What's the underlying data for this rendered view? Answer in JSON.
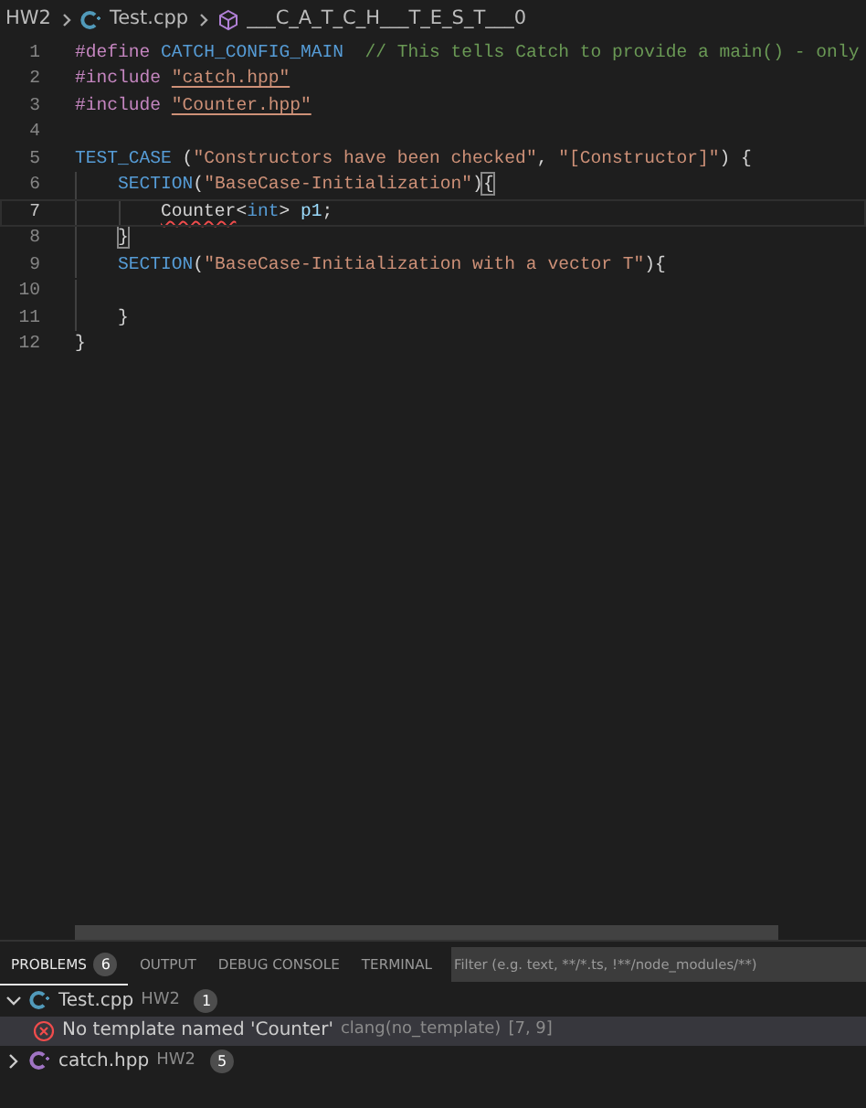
{
  "breadcrumb": [
    "HW2",
    "Test.cpp",
    "___C_A_T_C_H___T_E_S_T___0"
  ],
  "editor": {
    "lines": [
      {
        "number": "1",
        "current": false,
        "tokens": [
          {
            "kind": "directive",
            "text": "#define "
          },
          {
            "kind": "macro",
            "text": "CATCH_CONFIG_MAIN"
          },
          {
            "kind": "comment",
            "text": "  // This tells Catch to provide a main() - only"
          }
        ]
      },
      {
        "number": "2",
        "current": false,
        "tokens": [
          {
            "kind": "directive",
            "text": "#include "
          },
          {
            "kind": "string",
            "text": "\"catch.hpp\"",
            "underlined": true
          }
        ]
      },
      {
        "number": "3",
        "current": false,
        "tokens": [
          {
            "kind": "directive",
            "text": "#include "
          },
          {
            "kind": "string",
            "text": "\"Counter.hpp\"",
            "underlined": true
          }
        ]
      },
      {
        "number": "4",
        "current": false
      },
      {
        "number": "5",
        "current": false,
        "tokens": [
          {
            "kind": "macro",
            "text": "TEST_CASE"
          },
          {
            "kind": "plain",
            "text": " ("
          },
          {
            "kind": "string",
            "text": "\"Constructors have been checked\""
          },
          {
            "kind": "plain",
            "text": ", "
          },
          {
            "kind": "string",
            "text": "\"[Constructor]\""
          },
          {
            "kind": "plain",
            "text": ") {"
          }
        ],
        "children": [
          {
            "number": "6",
            "current": false,
            "tokens": [
              {
                "kind": "macro",
                "text": "SECTION"
              },
              {
                "kind": "plain",
                "text": "("
              },
              {
                "kind": "string",
                "text": "\"BaseCase-Initialization\""
              },
              {
                "kind": "plain",
                "text": ")"
              },
              {
                "kind": "plain",
                "text": "{",
                "matched": true
              }
            ],
            "children": [
              {
                "number": "7",
                "current": true,
                "tokens": [
                  {
                    "kind": "type",
                    "text": "Counter",
                    "error": true
                  },
                  {
                    "kind": "plain",
                    "text": "<"
                  },
                  {
                    "kind": "keyword",
                    "text": "int"
                  },
                  {
                    "kind": "plain",
                    "text": "> "
                  },
                  {
                    "kind": "variable",
                    "text": "p1"
                  },
                  {
                    "kind": "plain",
                    "text": ";"
                  }
                ]
              }
            ]
          },
          {
            "number": "8",
            "current": false,
            "tokens": [
              {
                "kind": "plain",
                "text": "}",
                "matched": true
              }
            ]
          },
          {
            "number": "9",
            "current": false,
            "tokens": [
              {
                "kind": "macro",
                "text": "SECTION"
              },
              {
                "kind": "plain",
                "text": "("
              },
              {
                "kind": "string",
                "text": "\"BaseCase-Initialization with a vector T\""
              },
              {
                "kind": "plain",
                "text": "){"
              }
            ]
          },
          {
            "number": "10",
            "current": false
          },
          {
            "number": "11",
            "current": false,
            "tokens": [
              {
                "kind": "plain",
                "text": "}"
              }
            ]
          }
        ]
      },
      {
        "number": "12",
        "current": false,
        "tokens": [
          {
            "kind": "plain",
            "text": "}"
          }
        ]
      }
    ]
  },
  "panel": {
    "tabs": [
      {
        "label": "PROBLEMS",
        "count": "6",
        "selected": true
      },
      {
        "label": "OUTPUT",
        "selected": false
      },
      {
        "label": "DEBUG CONSOLE",
        "selected": false
      },
      {
        "label": "TERMINAL",
        "selected": false
      }
    ],
    "filter": {
      "placeholder": "Filter (e.g. text, **/*.ts, !**/node_modules/**)"
    },
    "files": [
      {
        "name": "Test.cpp",
        "folder": "HW2",
        "count": "1",
        "expanded": true,
        "problems": [
          {
            "message": "No template named 'Counter'",
            "source": "clang(no_template)",
            "position": "[7, 9]",
            "selected": true
          }
        ]
      },
      {
        "name": "catch.hpp",
        "folder": "HW2",
        "count": "5",
        "expanded": false
      }
    ]
  }
}
